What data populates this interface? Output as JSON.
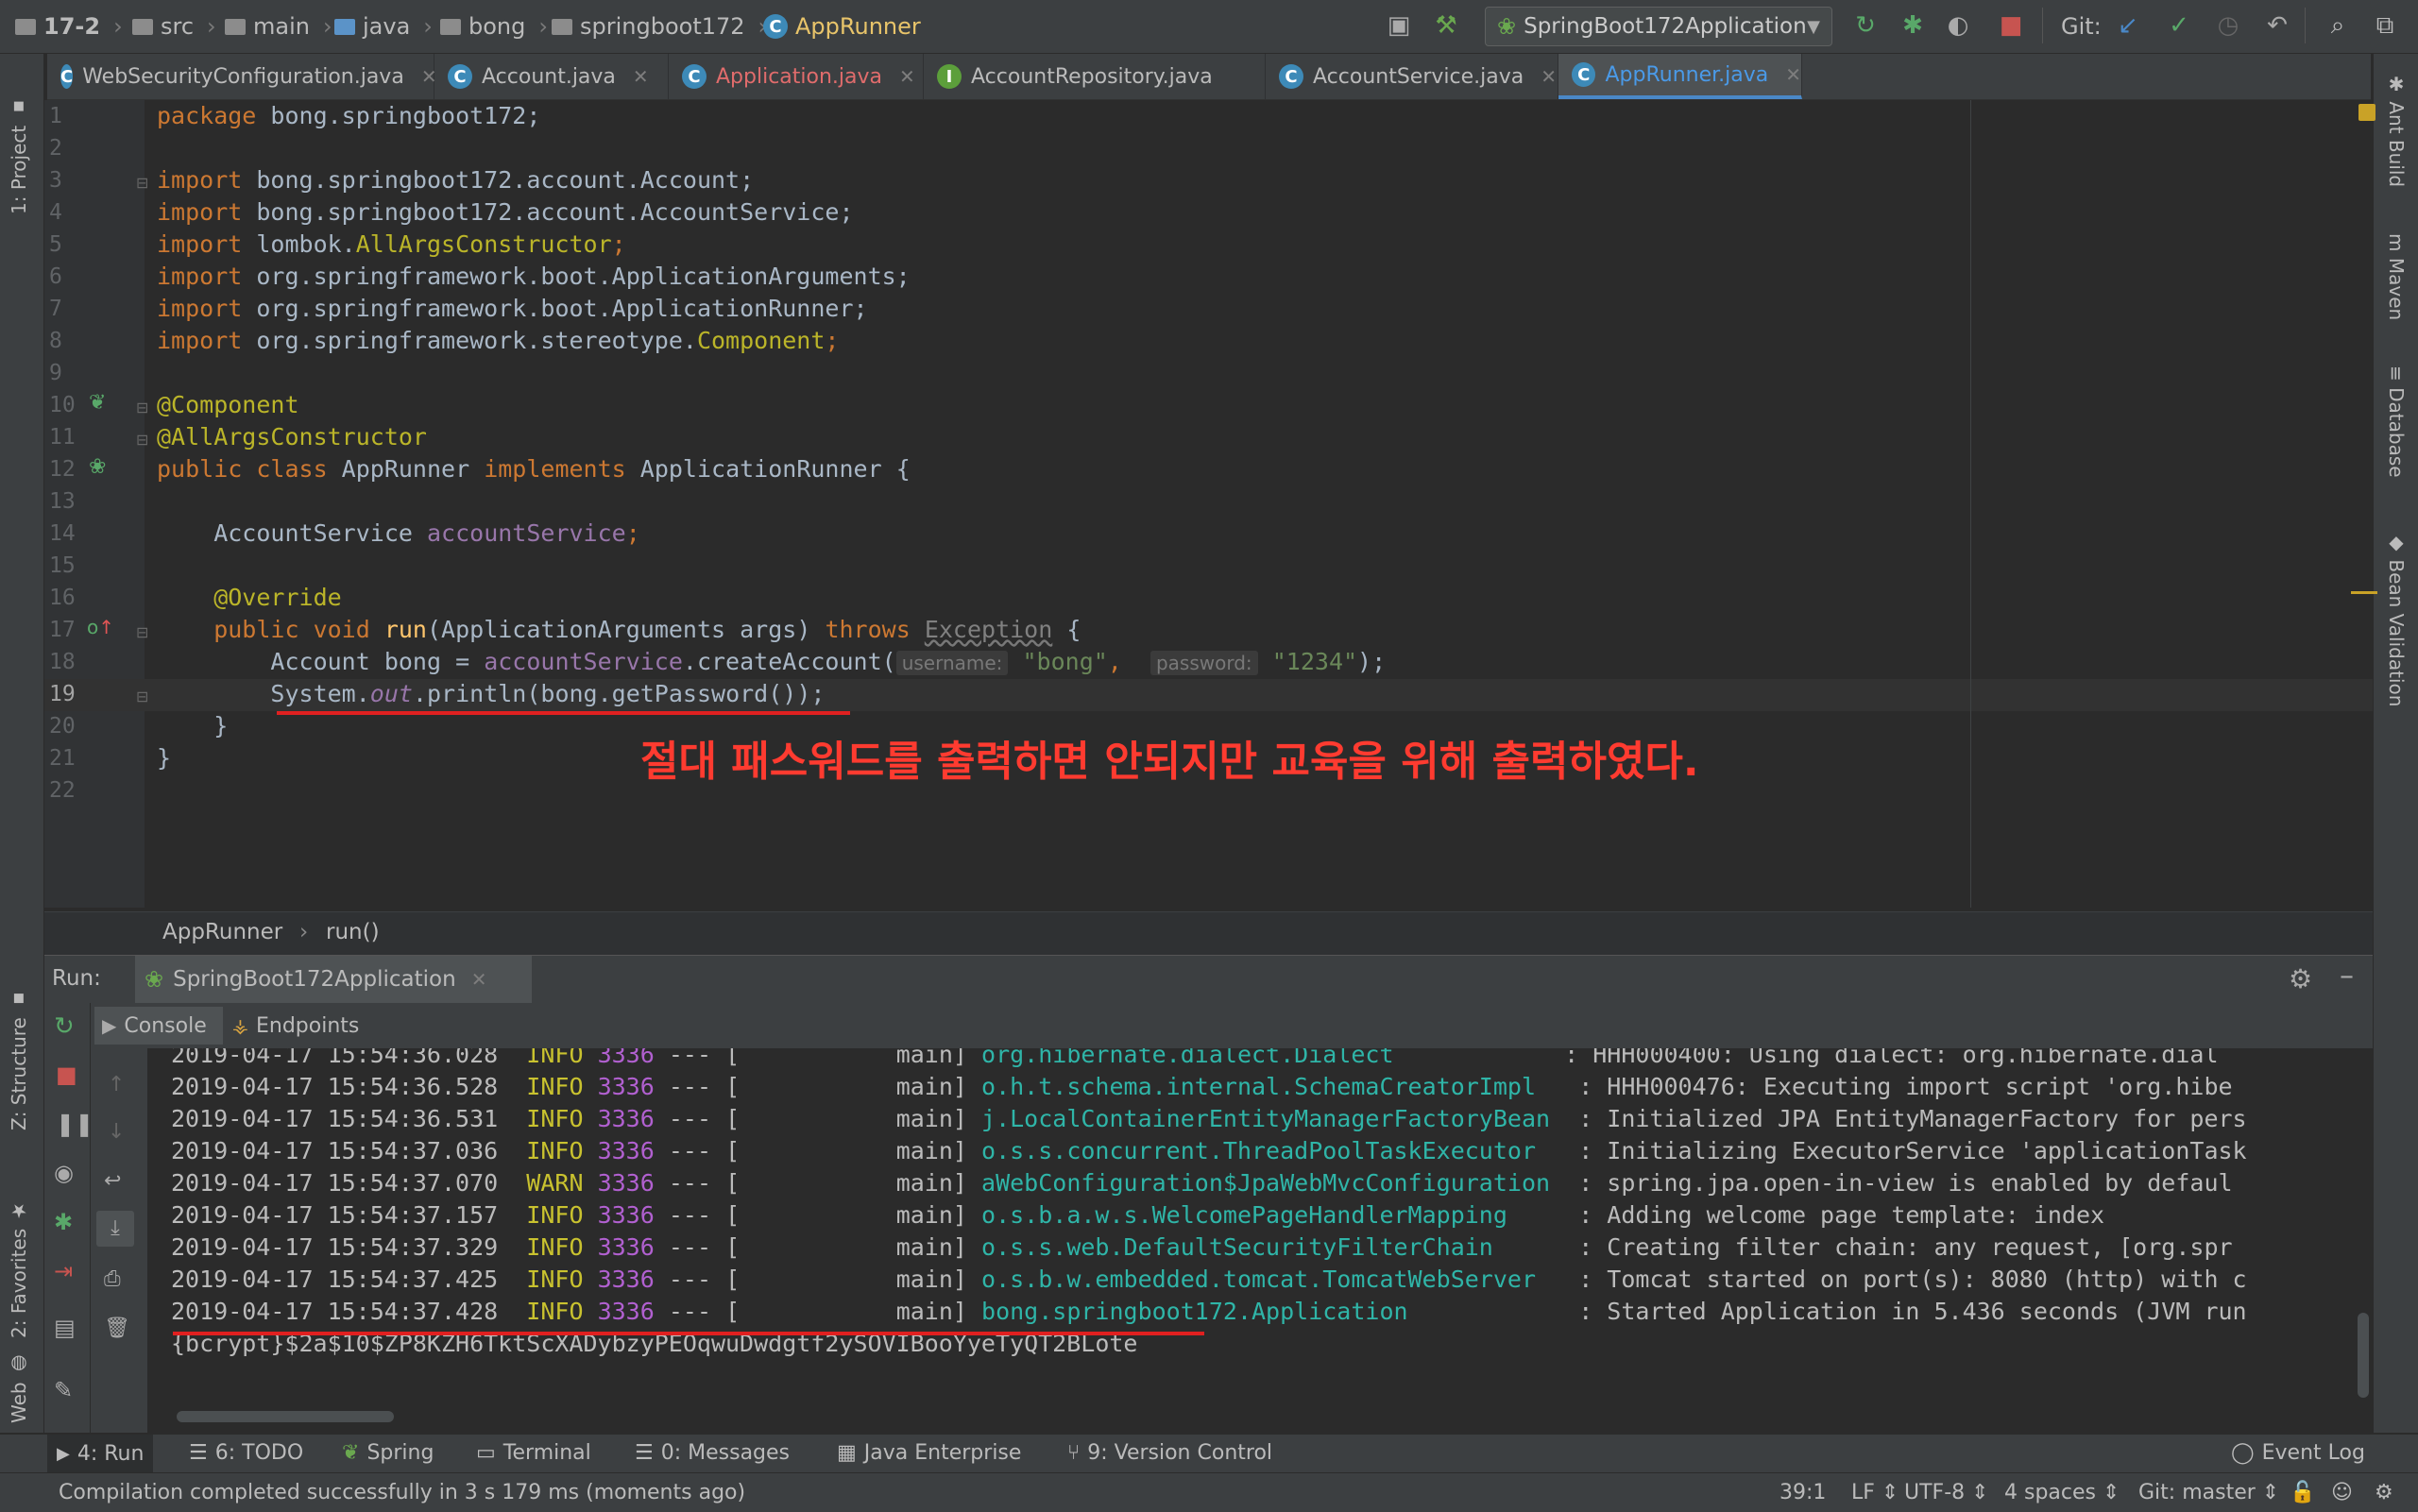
{
  "breadcrumb": [
    "17-2",
    "src",
    "main",
    "java",
    "bong",
    "springboot172",
    "AppRunner"
  ],
  "run_config": "SpringBoot172Application",
  "git_label": "Git:",
  "tabs": [
    {
      "label": "WebSecurityConfiguration.java",
      "icon": "class-icon",
      "color": "#bbbbbb"
    },
    {
      "label": "Account.java",
      "icon": "class-icon",
      "color": "#bbbbbb"
    },
    {
      "label": "Application.java",
      "icon": "spring-class-icon",
      "color": "#e06c6c"
    },
    {
      "label": "AccountRepository.java",
      "icon": "interface-icon",
      "color": "#bbbbbb"
    },
    {
      "label": "AccountService.java",
      "icon": "class-icon",
      "color": "#bbbbbb"
    },
    {
      "label": "AppRunner.java",
      "icon": "class-icon",
      "color": "#4a9ae8",
      "active": true
    }
  ],
  "left_tools": [
    "1: Project",
    "Z: Structure",
    "2: Favorites",
    "Web"
  ],
  "right_tools": [
    "Ant Build",
    "Maven",
    "Database",
    "Bean Validation"
  ],
  "line_numbers": [
    "1",
    "2",
    "3",
    "4",
    "5",
    "6",
    "7",
    "8",
    "9",
    "10",
    "11",
    "12",
    "13",
    "14",
    "15",
    "16",
    "17",
    "18",
    "19",
    "20",
    "21",
    "22"
  ],
  "code": {
    "l1_kw": "package",
    "l1_rest": " bong.springboot172;",
    "l3_kw": "import",
    "l3_rest": " bong.springboot172.account.Account;",
    "l4_kw": "import",
    "l4_rest": " bong.springboot172.account.AccountService;",
    "l5_kw": "import",
    "l5_a": " lombok.",
    "l5_b": "AllArgsConstructor",
    "l5_c": ";",
    "l6_kw": "import",
    "l6_rest": " org.springframework.boot.ApplicationArguments;",
    "l7_kw": "import",
    "l7_rest": " org.springframework.boot.ApplicationRunner;",
    "l8_kw": "import",
    "l8_a": " org.springframework.stereotype.",
    "l8_b": "Component",
    "l8_c": ";",
    "l10": "@Component",
    "l11": "@AllArgsConstructor",
    "l12_kw1": "public class",
    "l12_a": " AppRunner ",
    "l12_kw2": "implements",
    "l12_b": " ApplicationRunner {",
    "l14_a": "    AccountService ",
    "l14_b": "accountService",
    "l14_c": ";",
    "l16": "    @Override",
    "l17_kw": "    public void",
    "l17_fn": " run",
    "l17_a": "(ApplicationArguments args) ",
    "l17_kw2": "throws",
    "l17_b": " ",
    "l17_ex": "Exception",
    "l17_c": " {",
    "l18_a": "        Account bong = ",
    "l18_b": "accountService",
    "l18_c": ".createAccount(",
    "l18_h1": "username:",
    "l18_s1": "\"bong\"",
    "l18_d": ", ",
    "l18_h2": "password:",
    "l18_s2": "\"1234\"",
    "l18_e": ");",
    "l19_a": "        System.",
    "l19_b": "out",
    "l19_c": ".println(bong.getPassword());",
    "l20": "    }",
    "l21": "}"
  },
  "annotation_note": "절대 패스워드를 출력하면 안되지만 교육을 위해 출력하였다.",
  "editor_breadcrumb": [
    "AppRunner",
    "run()"
  ],
  "run_panel": {
    "label": "Run:",
    "config_tab": "SpringBoot172Application",
    "console_tab": "Console",
    "endpoints_tab": "Endpoints"
  },
  "log_lines": [
    {
      "ts": "2019-04-17 15:54:36.028",
      "level": "INFO",
      "pid": "3336",
      "sep": "---",
      "thread": "[           main]",
      "logger": "org.hibernate.dialect.Dialect           ",
      "msg": ": HHH000400: Using dialect: org.hibernate.dial"
    },
    {
      "ts": "2019-04-17 15:54:36.528",
      "level": "INFO",
      "pid": "3336",
      "sep": "---",
      "thread": "[           main]",
      "logger": "o.h.t.schema.internal.SchemaCreatorImpl  ",
      "msg": ": HHH000476: Executing import script 'org.hibe"
    },
    {
      "ts": "2019-04-17 15:54:36.531",
      "level": "INFO",
      "pid": "3336",
      "sep": "---",
      "thread": "[           main]",
      "logger": "j.LocalContainerEntityManagerFactoryBean ",
      "msg": ": Initialized JPA EntityManagerFactory for pers"
    },
    {
      "ts": "2019-04-17 15:54:37.036",
      "level": "INFO",
      "pid": "3336",
      "sep": "---",
      "thread": "[           main]",
      "logger": "o.s.s.concurrent.ThreadPoolTaskExecutor  ",
      "msg": ": Initializing ExecutorService 'applicationTask"
    },
    {
      "ts": "2019-04-17 15:54:37.070",
      "level": "WARN",
      "pid": "3336",
      "sep": "---",
      "thread": "[           main]",
      "logger": "aWebConfiguration$JpaWebMvcConfiguration ",
      "msg": ": spring.jpa.open-in-view is enabled by defaul"
    },
    {
      "ts": "2019-04-17 15:54:37.157",
      "level": "INFO",
      "pid": "3336",
      "sep": "---",
      "thread": "[           main]",
      "logger": "o.s.b.a.w.s.WelcomePageHandlerMapping    ",
      "msg": ": Adding welcome page template: index"
    },
    {
      "ts": "2019-04-17 15:54:37.329",
      "level": "INFO",
      "pid": "3336",
      "sep": "---",
      "thread": "[           main]",
      "logger": "o.s.s.web.DefaultSecurityFilterChain     ",
      "msg": ": Creating filter chain: any request, [org.spr"
    },
    {
      "ts": "2019-04-17 15:54:37.425",
      "level": "INFO",
      "pid": "3336",
      "sep": "---",
      "thread": "[           main]",
      "logger": "o.s.b.w.embedded.tomcat.TomcatWebServer  ",
      "msg": ": Tomcat started on port(s): 8080 (http) with c"
    },
    {
      "ts": "2019-04-17 15:54:37.428",
      "level": "INFO",
      "pid": "3336",
      "sep": "---",
      "thread": "[           main]",
      "logger": "bong.springboot172.Application           ",
      "msg": ": Started Application in 5.436 seconds (JVM run"
    }
  ],
  "password_output": "{bcrypt}$2a$10$ZP8KZH6TktScXADybzyPEOqwuDwdgtf2ySOVIBooYyeTyQT2BLote",
  "tool_windows": [
    {
      "label": "4: Run",
      "active": true
    },
    {
      "label": "6: TODO"
    },
    {
      "label": "Spring"
    },
    {
      "label": "Terminal"
    },
    {
      "label": "0: Messages"
    },
    {
      "label": "Java Enterprise"
    },
    {
      "label": "9: Version Control"
    }
  ],
  "event_log": "Event Log",
  "status": {
    "message": "Compilation completed successfully in 3 s 179 ms (moments ago)",
    "position": "39:1",
    "line_sep": "LF",
    "encoding": "UTF-8",
    "indent": "4 spaces",
    "vcs": "Git: master"
  },
  "colors": {
    "accent": "#4a88c7",
    "annotation_red": "#e02020",
    "keyword": "#cc7832",
    "annotation": "#bbb529",
    "string": "#6a8759"
  }
}
